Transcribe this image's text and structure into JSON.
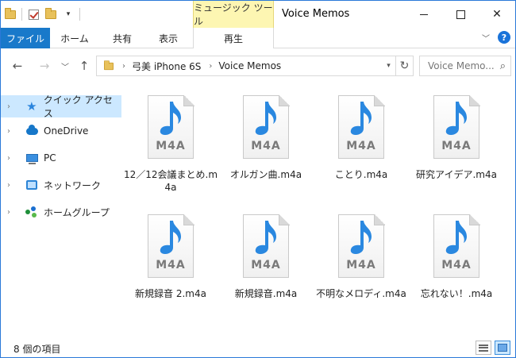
{
  "titlebar": {
    "tool_tab": "ミュージック ツール",
    "title": "Voice Memos"
  },
  "ribbon": {
    "tabs": [
      "ファイル",
      "ホーム",
      "共有",
      "表示",
      "再生"
    ]
  },
  "address": {
    "crumbs": [
      "弓美 iPhone 6S",
      "Voice Memos"
    ],
    "search_placeholder": "Voice Memo..."
  },
  "sidebar": {
    "items": [
      {
        "label": "クイック アクセス",
        "icon": "quick-access-star-icon"
      },
      {
        "label": "OneDrive",
        "icon": "onedrive-cloud-icon"
      },
      {
        "label": "PC",
        "icon": "pc-icon"
      },
      {
        "label": "ネットワーク",
        "icon": "network-icon"
      },
      {
        "label": "ホームグループ",
        "icon": "homegroup-icon"
      }
    ]
  },
  "files": {
    "items": [
      {
        "name": "12／12会議まとめ.m4a",
        "ext": "M4A"
      },
      {
        "name": "オルガン曲.m4a",
        "ext": "M4A"
      },
      {
        "name": "ことり.m4a",
        "ext": "M4A"
      },
      {
        "name": "研究アイデア.m4a",
        "ext": "M4A"
      },
      {
        "name": "新規録音 2.m4a",
        "ext": "M4A"
      },
      {
        "name": "新規録音.m4a",
        "ext": "M4A"
      },
      {
        "name": "不明なメロディ.m4a",
        "ext": "M4A"
      },
      {
        "name": "忘れない！.m4a",
        "ext": "M4A"
      }
    ]
  },
  "status": {
    "item_count": "8 個の項目"
  },
  "colors": {
    "accent": "#1979ca",
    "music_tool_tab": "#fdf6b2",
    "selected": "#cce8ff",
    "note_blue": "#2a88e0"
  }
}
